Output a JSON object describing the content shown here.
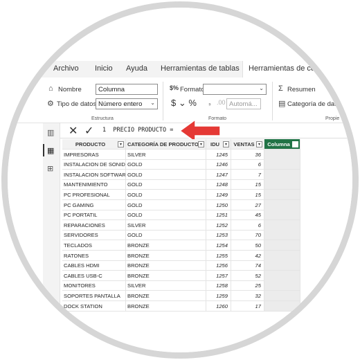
{
  "tabs": [
    {
      "label": "Archivo"
    },
    {
      "label": "Inicio"
    },
    {
      "label": "Ayuda"
    },
    {
      "label": "Herramientas de tablas"
    },
    {
      "label": "Herramientas de colu"
    }
  ],
  "ribbon": {
    "nombre_label": "Nombre",
    "nombre_value": "Columna",
    "tipo_label": "Tipo de datos",
    "tipo_value": "Número entero",
    "estructura_label": "Estructura",
    "formato_label": "Formato",
    "formato_value": "",
    "currency_symbols": "$ ⌄ %",
    "auto_value": "Automá...",
    "formato_group_label": "Formato",
    "resumen_label": "Resumen",
    "categoria_label": "Categoría de datos",
    "propiedades_label": "Propie"
  },
  "formula": {
    "cancel": "✕",
    "commit": "✓",
    "text": "1  PRECIO PRODUCTO ="
  },
  "table": {
    "columns": [
      "PRODUCTO",
      "CATEGORÍA DE PRODUCTOS",
      "IDU",
      "VENTAS",
      "Columna"
    ],
    "rows": [
      [
        "IMPRESORAS",
        "SILVER",
        "1245",
        "36"
      ],
      [
        "INSTALACION DE SONIDO",
        "GOLD",
        "1246",
        "6"
      ],
      [
        "INSTALACION SOFTWARE",
        "GOLD",
        "1247",
        "7"
      ],
      [
        "MANTENIMIENTO",
        "GOLD",
        "1248",
        "15"
      ],
      [
        "PC PROFESIONAL",
        "GOLD",
        "1249",
        "15"
      ],
      [
        "PC GAMING",
        "GOLD",
        "1250",
        "27"
      ],
      [
        "PC PORTATIL",
        "GOLD",
        "1251",
        "45"
      ],
      [
        "REPARACIONES",
        "SILVER",
        "1252",
        "6"
      ],
      [
        "SERVIDORES",
        "GOLD",
        "1253",
        "70"
      ],
      [
        "TECLADOS",
        "BRONZE",
        "1254",
        "50"
      ],
      [
        "RATONES",
        "BRONZE",
        "1255",
        "42"
      ],
      [
        "CABLES HDMI",
        "BRONZE",
        "1256",
        "74"
      ],
      [
        "CABLES USB-C",
        "BRONZE",
        "1257",
        "52"
      ],
      [
        "MONITORES",
        "SILVER",
        "1258",
        "25"
      ],
      [
        "SOPORTES PANTALLA",
        "BRONZE",
        "1259",
        "32"
      ],
      [
        "DOCK STATION",
        "BRONZE",
        "1260",
        "17"
      ]
    ]
  },
  "colors": {
    "accent": "#217346",
    "arrow": "#e53935"
  }
}
